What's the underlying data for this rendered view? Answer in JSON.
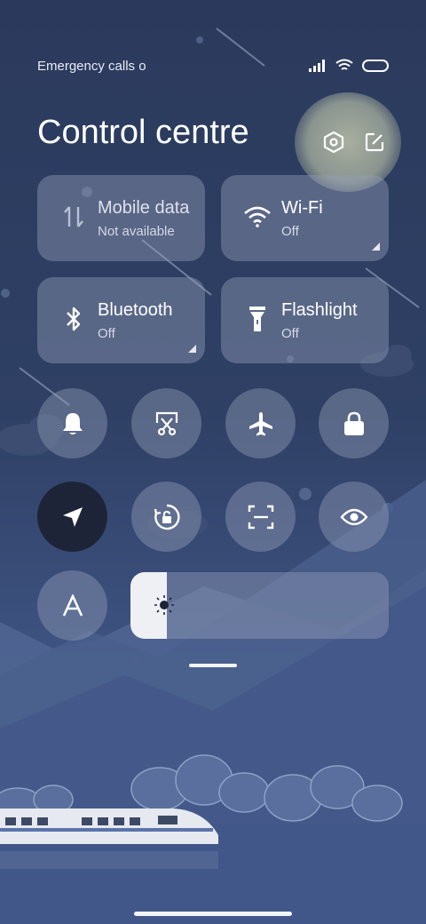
{
  "status": {
    "carrier_text": "Emergency calls o"
  },
  "header": {
    "title": "Control centre"
  },
  "tiles": [
    {
      "name": "Mobile data",
      "state": "Not available",
      "icon": "mobile-data-icon"
    },
    {
      "name": "Wi-Fi",
      "state": "Off",
      "icon": "wifi-icon"
    },
    {
      "name": "Bluetooth",
      "state": "Off",
      "icon": "bluetooth-icon"
    },
    {
      "name": "Flashlight",
      "state": "Off",
      "icon": "flashlight-icon"
    }
  ],
  "toggles": [
    {
      "icon": "bell-icon",
      "active": false
    },
    {
      "icon": "screenshot-scissors-icon",
      "active": false
    },
    {
      "icon": "airplane-icon",
      "active": false
    },
    {
      "icon": "lock-icon",
      "active": false
    },
    {
      "icon": "location-arrow-icon",
      "active": true
    },
    {
      "icon": "rotation-lock-icon",
      "active": false
    },
    {
      "icon": "scan-icon",
      "active": false
    },
    {
      "icon": "eye-icon",
      "active": false
    },
    {
      "icon": "font-A-icon",
      "active": false
    }
  ],
  "brightness": {
    "level": 0.14
  },
  "colors": {
    "accent_active": "#1d2438",
    "tile_bg": "rgba(150,160,185,0.42)"
  }
}
